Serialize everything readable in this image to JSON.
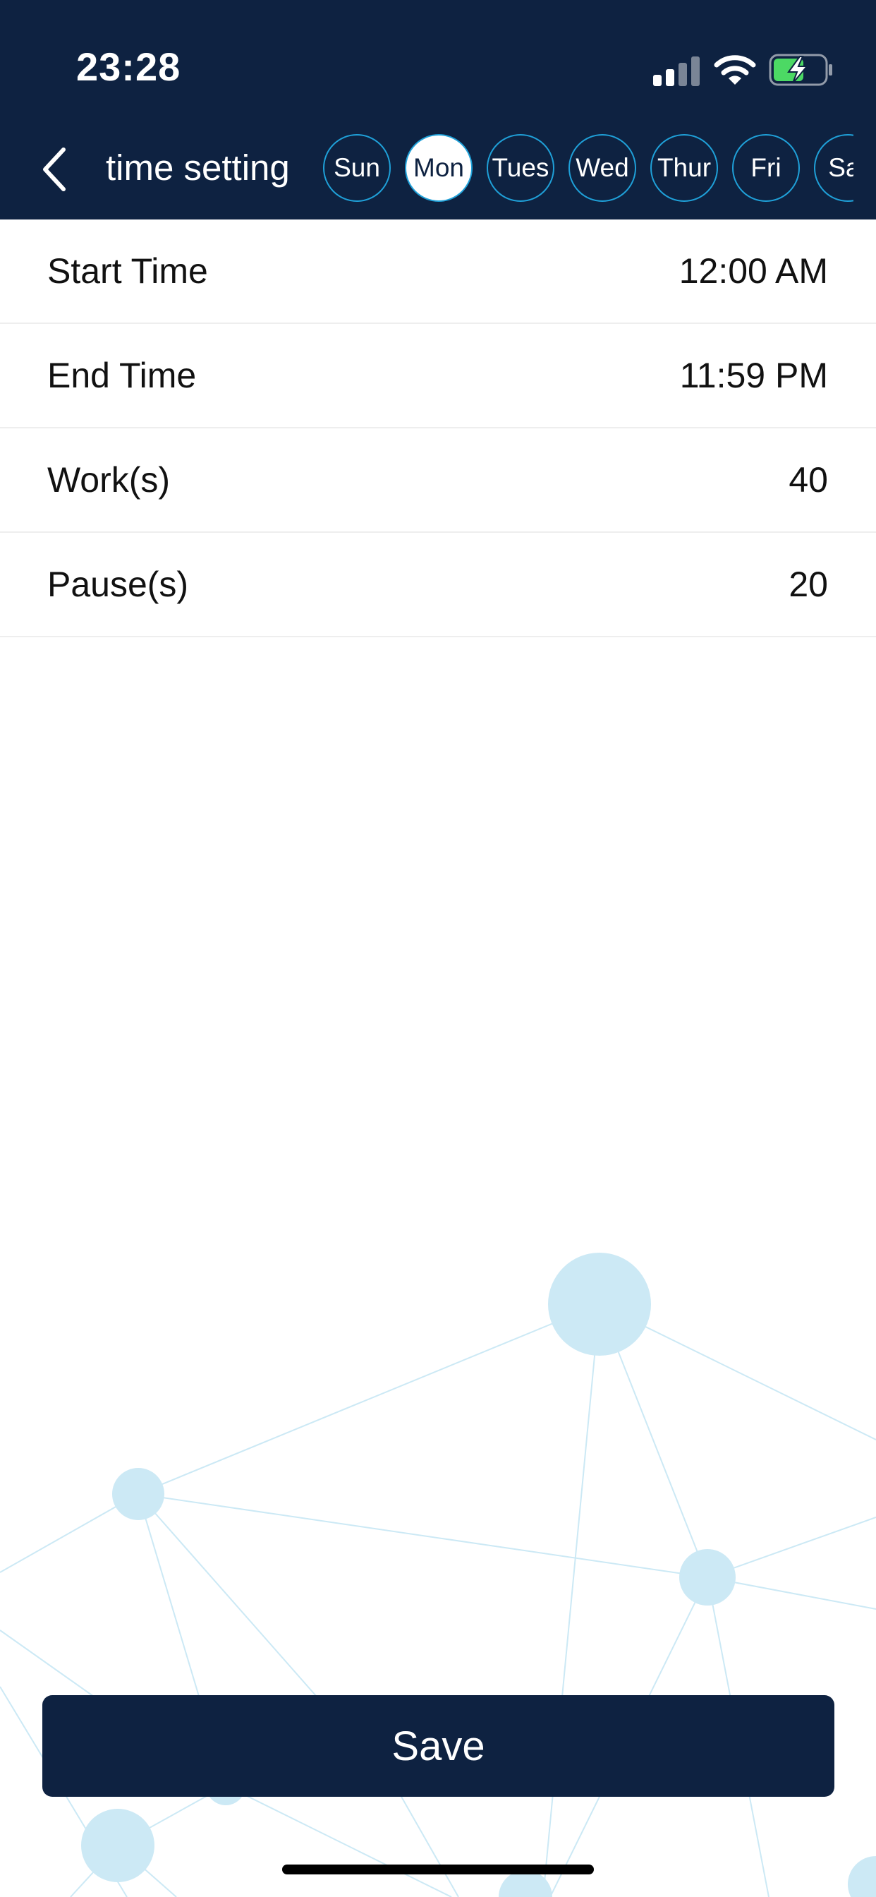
{
  "status_bar": {
    "time": "23:28",
    "signal_icon": "cellular-signal-icon",
    "wifi_icon": "wifi-icon",
    "battery_icon": "battery-charging-icon",
    "battery_color": "#4cd964"
  },
  "header": {
    "back_icon": "chevron-left-icon",
    "title": "time setting",
    "background_color": "#0e2241",
    "days": [
      {
        "label": "Sun",
        "selected": false
      },
      {
        "label": "Mon",
        "selected": true
      },
      {
        "label": "Tues",
        "selected": false
      },
      {
        "label": "Wed",
        "selected": false
      },
      {
        "label": "Thur",
        "selected": false
      },
      {
        "label": "Fri",
        "selected": false
      },
      {
        "label": "Sat",
        "selected": false
      }
    ],
    "day_ring_color": "#1fa0d8"
  },
  "settings": [
    {
      "label": "Start Time",
      "value": "12:00 AM"
    },
    {
      "label": "End Time",
      "value": "11:59 PM"
    },
    {
      "label": "Work(s)",
      "value": "40"
    },
    {
      "label": "Pause(s)",
      "value": "20"
    }
  ],
  "save_button": {
    "label": "Save"
  },
  "decoration": {
    "network_color": "#cce9f5"
  }
}
